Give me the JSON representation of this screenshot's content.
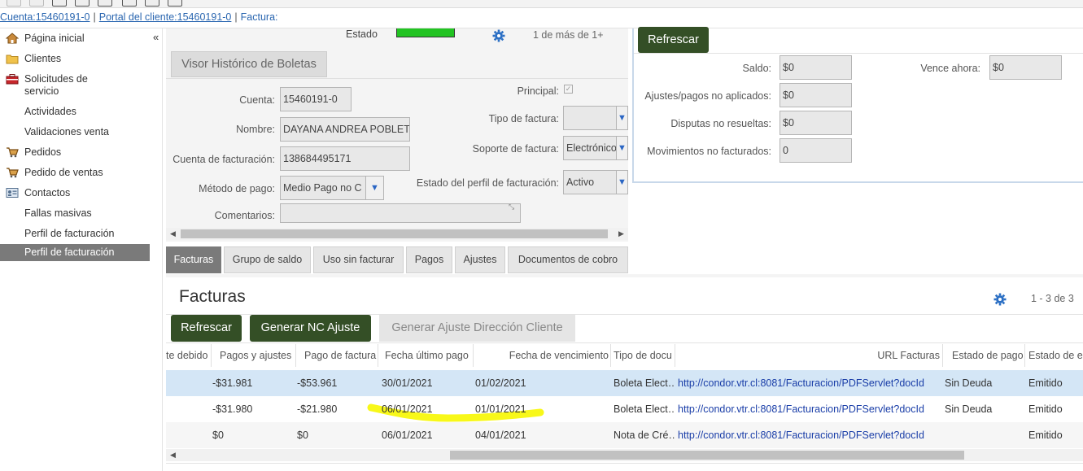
{
  "breadcrumb": {
    "account": "Cuenta:15460191-0",
    "portal": "Portal del cliente:15460191-0",
    "current": "Factura:"
  },
  "sidebar": {
    "items": [
      {
        "label": "Página inicial",
        "icon": "home-icon"
      },
      {
        "label": "Clientes",
        "icon": "folder-icon"
      },
      {
        "label": "Solicitudes de servicio",
        "icon": "toolbox-icon"
      },
      {
        "label": "Actividades",
        "icon": ""
      },
      {
        "label": "Validaciones venta",
        "icon": ""
      },
      {
        "label": "Pedidos",
        "icon": "cart-icon"
      },
      {
        "label": "Pedido de ventas",
        "icon": "cart-icon"
      },
      {
        "label": "Contactos",
        "icon": "contact-card-icon"
      },
      {
        "label": "Fallas masivas",
        "icon": ""
      },
      {
        "label": "Perfil de facturación",
        "icon": ""
      },
      {
        "label": "Perfil de facturación",
        "icon": "",
        "active": true
      }
    ],
    "collapse_label": "«"
  },
  "profile": {
    "estado_label": "Estado",
    "estado_color": "#22c322",
    "pager": "1 de más de 1+",
    "visor_button": "Visor Histórico de Boletas",
    "cuenta_label": "Cuenta:",
    "cuenta_value": "15460191-0",
    "nombre_label": "Nombre:",
    "nombre_value": "DAYANA ANDREA POBLETE",
    "cuenta_fact_label": "Cuenta de facturación:",
    "cuenta_fact_value": "138684495171",
    "metodo_label": "Método de pago:",
    "metodo_value": "Medio Pago no C",
    "comentarios_label": "Comentarios:",
    "comentarios_value": "",
    "principal_label": "Principal:",
    "tipo_factura_label": "Tipo de factura:",
    "tipo_factura_value": "",
    "soporte_label": "Soporte de factura:",
    "soporte_value": "Electrónico",
    "estado_perfil_label": "Estado del perfil de facturación:",
    "estado_perfil_value": "Activo"
  },
  "summary": {
    "refresh_label": "Refrescar",
    "saldo_label": "Saldo:",
    "saldo_value": "$0",
    "vence_label": "Vence ahora:",
    "vence_value": "$0",
    "ajustes_label": "Ajustes/pagos no aplicados:",
    "ajustes_value": "$0",
    "disputas_label": "Disputas no resueltas:",
    "disputas_value": "$0",
    "movimientos_label": "Movimientos no facturados:",
    "movimientos_value": "0"
  },
  "tabs": [
    "Facturas",
    "Grupo de saldo",
    "Uso sin facturar",
    "Pagos",
    "Ajustes",
    "Documentos de cobro"
  ],
  "facturas": {
    "title": "Facturas",
    "pager": "1 - 3 de 3",
    "btn_refresh": "Refrescar",
    "btn_nc": "Generar NC Ajuste",
    "btn_dir": "Generar Ajuste Dirección Cliente",
    "columns": [
      "te debido",
      "Pagos y ajustes",
      "Pago de factura",
      "Fecha último pago",
      "Fecha de vencimiento",
      "Tipo de docu",
      "URL Facturas",
      "Estado de pago",
      "Estado de e"
    ],
    "rows": [
      [
        "",
        "-$31.981",
        "-$53.961",
        "30/01/2021",
        "01/02/2021",
        "Boleta Elect…",
        "http://condor.vtr.cl:8081/Facturacion/PDFServlet?docId",
        "Sin Deuda",
        "Emitido"
      ],
      [
        "",
        "-$31.980",
        "-$21.980",
        "06/01/2021",
        "01/01/2021",
        "Boleta Elect…",
        "http://condor.vtr.cl:8081/Facturacion/PDFServlet?docId",
        "Sin Deuda",
        "Emitido"
      ],
      [
        "",
        "$0",
        "$0",
        "06/01/2021",
        "04/01/2021",
        "Nota de Cré…",
        "http://condor.vtr.cl:8081/Facturacion/PDFServlet?docId",
        "",
        "Emitido"
      ]
    ],
    "selected_row_color": "#d4e6f6",
    "highlight_color": "#f7f700"
  }
}
